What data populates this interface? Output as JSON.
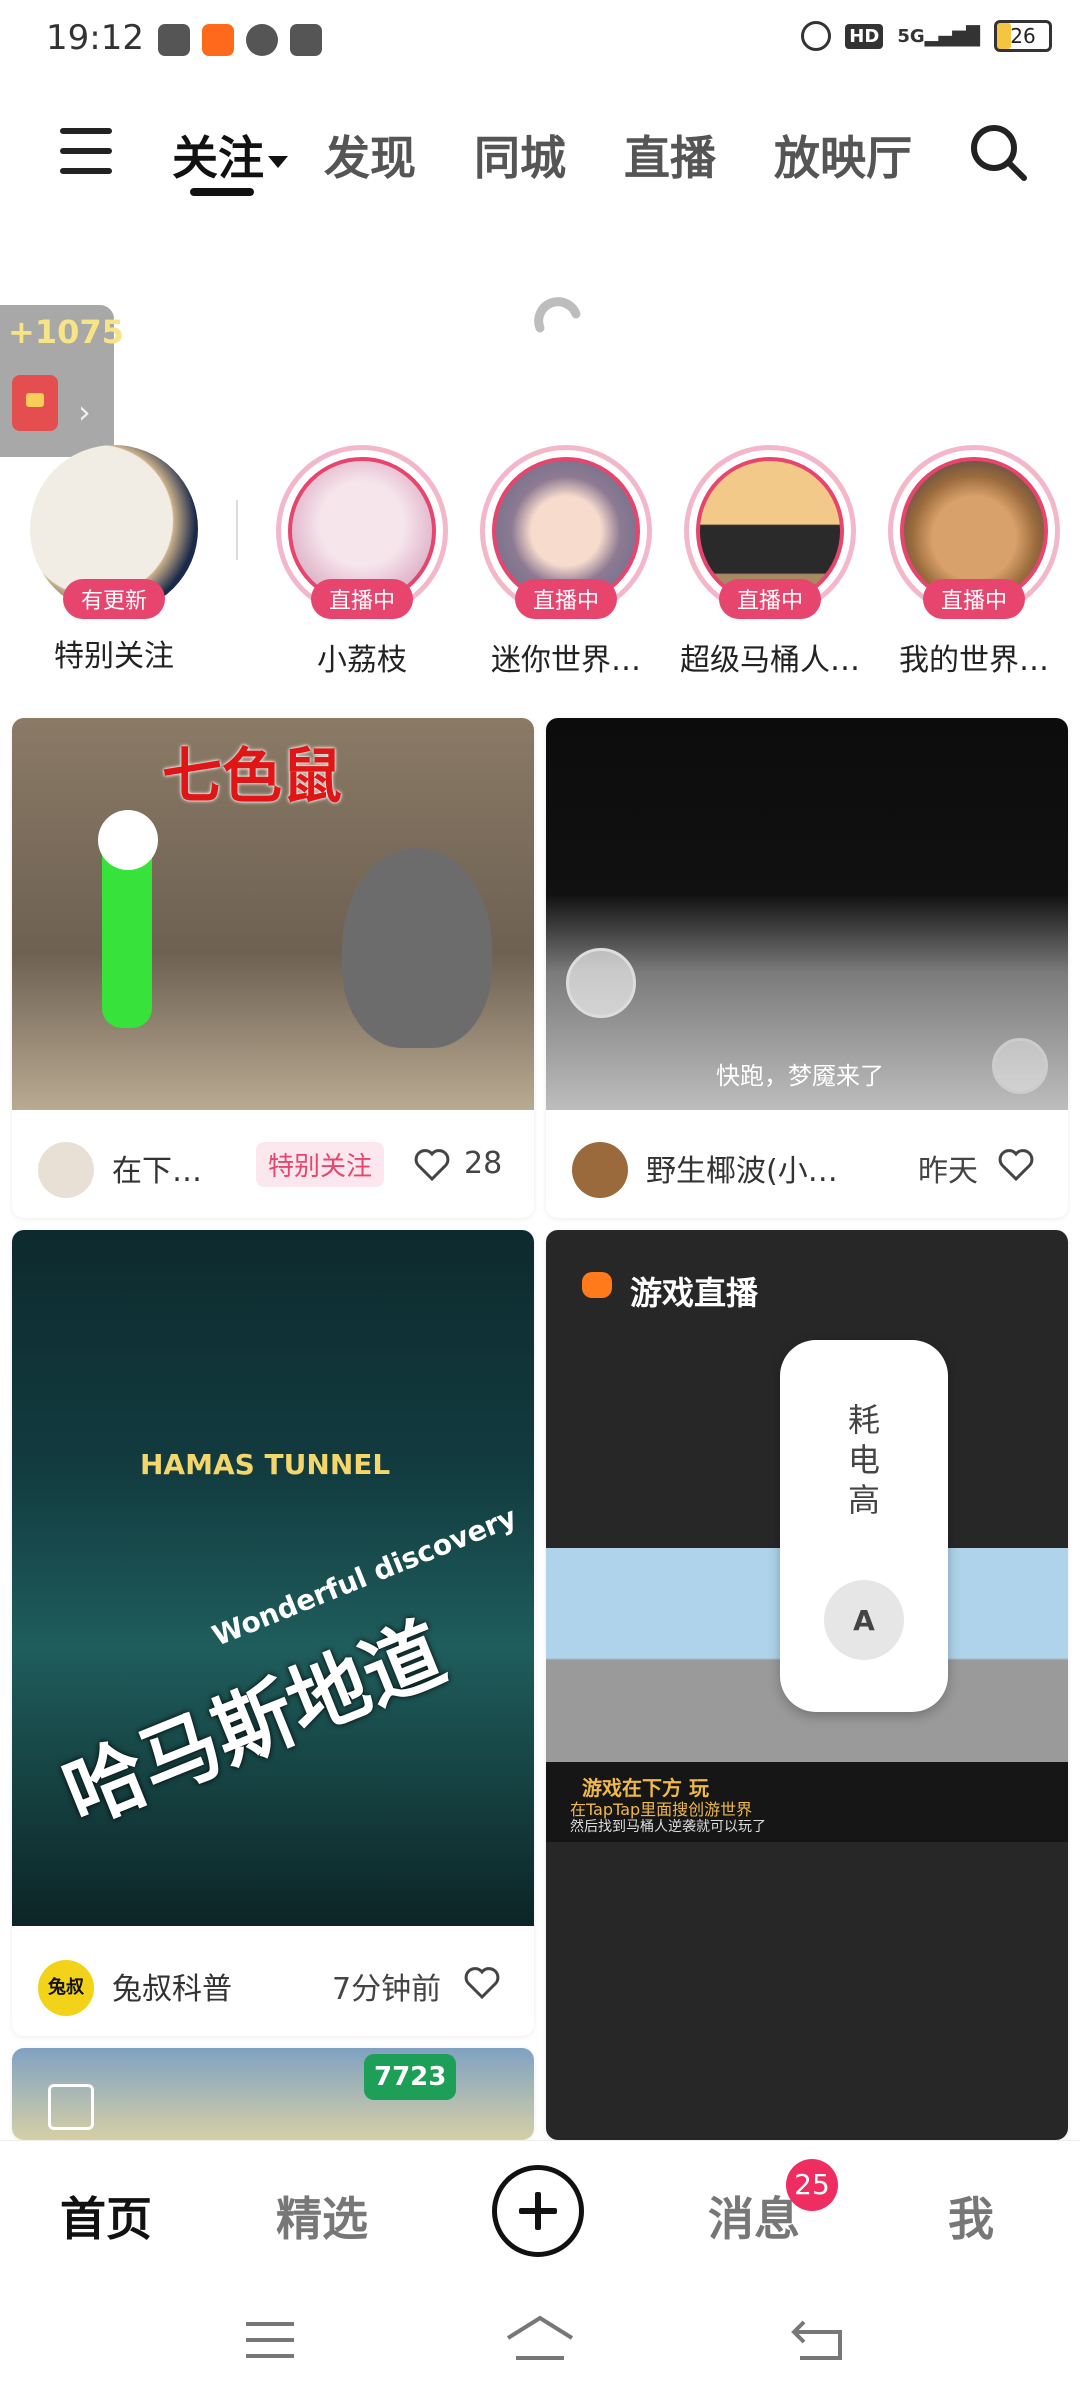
{
  "status": {
    "time": "19:12",
    "battery": "26",
    "network": "5G",
    "hd": "HD"
  },
  "nav": {
    "tabs": [
      "关注",
      "发现",
      "同城",
      "直播",
      "放映厅"
    ],
    "active_tab": "关注"
  },
  "red_packet": {
    "amount": "+1075"
  },
  "stories": [
    {
      "name": "特别关注",
      "badge": "有更新"
    },
    {
      "name": "小荔枝",
      "badge": "直播中"
    },
    {
      "name": "迷你世界…",
      "badge": "直播中"
    },
    {
      "name": "超级马桶人…",
      "badge": "直播中"
    },
    {
      "name": "我的世界…",
      "badge": "直播中"
    }
  ],
  "feed": {
    "card1": {
      "title_overlay": "七色鼠",
      "author": "在下…",
      "tag": "特别关注",
      "likes": "28"
    },
    "card2": {
      "caption": "快跑，梦魇来了",
      "author": "野生椰波(小…",
      "time": "昨天"
    },
    "card3": {
      "sign": "HAMAS TUNNEL",
      "subtitle": "Wonderful discovery",
      "title_overlay": "哈马斯地道",
      "author": "兔叔科普",
      "author_badge": "兔叔",
      "time": "7分钟前"
    },
    "card4": {
      "live_label": "游戏直播",
      "line1": "游戏在下方",
      "line1b": "玩",
      "line2": "在TapTap里面搜创游世界",
      "line3": "然后找到马桶人逆袭就可以玩了"
    },
    "card5": {
      "number": "7723"
    }
  },
  "popup": {
    "text": "耗电高",
    "knob": "A"
  },
  "bottom_nav": {
    "items": [
      "首页",
      "精选",
      "消息",
      "我"
    ],
    "message_badge": "25"
  },
  "colors": {
    "accent": "#e8456e",
    "badge": "#ef2d61"
  }
}
